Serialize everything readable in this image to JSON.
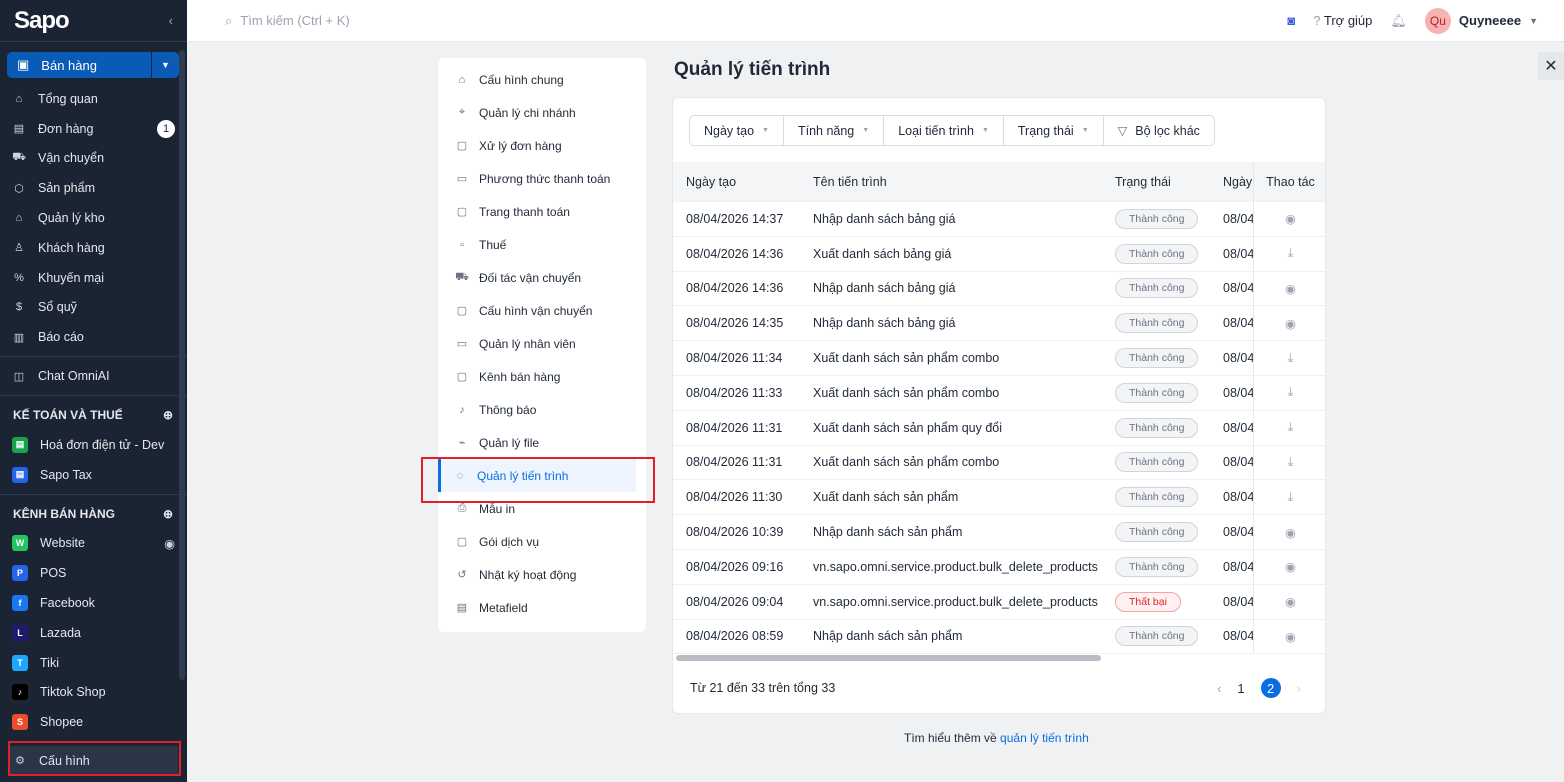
{
  "sidebar": {
    "brand": "Sapo",
    "channel_select": "Bán hàng",
    "items": [
      {
        "icon": "home-icon",
        "g": "⌂",
        "label": "Tổng quan"
      },
      {
        "icon": "order-icon",
        "g": "▤",
        "label": "Đơn hàng",
        "badge": "1"
      },
      {
        "icon": "truck-icon",
        "g": "⛟",
        "label": "Vận chuyển"
      },
      {
        "icon": "box-icon",
        "g": "⬡",
        "label": "Sản phẩm"
      },
      {
        "icon": "warehouse-icon",
        "g": "⌂",
        "label": "Quản lý kho"
      },
      {
        "icon": "user-icon",
        "g": "♙",
        "label": "Khách hàng"
      },
      {
        "icon": "discount-icon",
        "g": "%",
        "label": "Khuyến mại"
      },
      {
        "icon": "cashbook-icon",
        "g": "$",
        "label": "Sổ quỹ"
      },
      {
        "icon": "chart-icon",
        "g": "▥",
        "label": "Báo cáo"
      }
    ],
    "chat": "Chat OmniAI",
    "accounting": {
      "title": "KẾ TOÁN VÀ THUẾ",
      "items": [
        {
          "label": "Hoá đơn điện tử - Dev",
          "color": "#16a34a"
        },
        {
          "label": "Sapo Tax",
          "color": "#2563eb"
        }
      ]
    },
    "channels": {
      "title": "KÊNH BÁN HÀNG",
      "items": [
        {
          "label": "Website",
          "color": "#22c55e",
          "g": "W"
        },
        {
          "label": "POS",
          "color": "#2563eb",
          "g": "P"
        },
        {
          "label": "Facebook",
          "color": "#1877f2",
          "g": "f"
        },
        {
          "label": "Lazada",
          "color": "#1e1b6e",
          "g": "L"
        },
        {
          "label": "Tiki",
          "color": "#1ba8ff",
          "g": "T"
        },
        {
          "label": "Tiktok Shop",
          "color": "#000000",
          "g": "♪"
        },
        {
          "label": "Shopee",
          "color": "#ee4d2d",
          "g": "S"
        }
      ]
    },
    "settings": "Cấu hình"
  },
  "topbar": {
    "search_placeholder": "Tìm kiếm (Ctrl + K)",
    "help": "Trợ giúp",
    "avatar": "Qu",
    "user": "Quyneeee"
  },
  "settings_menu": [
    {
      "label": "Cấu hình chung",
      "g": "⌂"
    },
    {
      "label": "Quản lý chi nhánh",
      "g": "⌖"
    },
    {
      "label": "Xử lý đơn hàng",
      "g": "▢"
    },
    {
      "label": "Phương thức thanh toán",
      "g": "▭"
    },
    {
      "label": "Trang thanh toán",
      "g": "▢"
    },
    {
      "label": "Thuế",
      "g": "▫"
    },
    {
      "label": "Đối tác vận chuyển",
      "g": "⛟"
    },
    {
      "label": "Cấu hình vận chuyển",
      "g": "▢"
    },
    {
      "label": "Quản lý nhân viên",
      "g": "▭"
    },
    {
      "label": "Kênh bán hàng",
      "g": "▢"
    },
    {
      "label": "Thông báo",
      "g": "♪"
    },
    {
      "label": "Quản lý file",
      "g": "⌁"
    },
    {
      "label": "Quản lý tiến trình",
      "g": "◌",
      "active": true
    },
    {
      "label": "Mẫu in",
      "g": "⎙"
    },
    {
      "label": "Gói dịch vụ",
      "g": "▢"
    },
    {
      "label": "Nhật ký hoạt động",
      "g": "↺"
    },
    {
      "label": "Metafield",
      "g": "▤"
    }
  ],
  "page": {
    "title": "Quản lý tiến trình",
    "filters": [
      "Ngày tạo",
      "Tính năng",
      "Loại tiến trình",
      "Trạng thái"
    ],
    "more_filter": "Bộ lọc khác",
    "columns": [
      "Ngày tạo",
      "Tên tiến trình",
      "Trạng thái",
      "Ngày",
      "Thao tác"
    ],
    "rows": [
      [
        "08/04/2026 14:37",
        "Nhập danh sách bảng giá",
        "Thành công",
        "08/04",
        "view"
      ],
      [
        "08/04/2026 14:36",
        "Xuất danh sách bảng giá",
        "Thành công",
        "08/04",
        "download"
      ],
      [
        "08/04/2026 14:36",
        "Nhập danh sách bảng giá",
        "Thành công",
        "08/04",
        "view"
      ],
      [
        "08/04/2026 14:35",
        "Nhập danh sách bảng giá",
        "Thành công",
        "08/04",
        "view"
      ],
      [
        "08/04/2026 11:34",
        "Xuất danh sách sản phẩm combo",
        "Thành công",
        "08/04",
        "download"
      ],
      [
        "08/04/2026 11:33",
        "Xuất danh sách sản phẩm combo",
        "Thành công",
        "08/04",
        "download"
      ],
      [
        "08/04/2026 11:31",
        "Xuất danh sách sản phẩm quy đổi",
        "Thành công",
        "08/04",
        "download"
      ],
      [
        "08/04/2026 11:31",
        "Xuất danh sách sản phẩm combo",
        "Thành công",
        "08/04",
        "download"
      ],
      [
        "08/04/2026 11:30",
        "Xuất danh sách sản phẩm",
        "Thành công",
        "08/04",
        "download"
      ],
      [
        "08/04/2026 10:39",
        "Nhập danh sách sản phẩm",
        "Thành công",
        "08/04",
        "view"
      ],
      [
        "08/04/2026 09:16",
        "vn.sapo.omni.service.product.bulk_delete_products",
        "Thành công",
        "08/04",
        "view"
      ],
      [
        "08/04/2026 09:04",
        "vn.sapo.omni.service.product.bulk_delete_products",
        "Thất bại",
        "08/04",
        "view"
      ],
      [
        "08/04/2026 08:59",
        "Nhập danh sách sản phẩm",
        "Thành công",
        "08/04",
        "view"
      ]
    ],
    "summary": "Từ 21 đến 33 trên tổng 33",
    "pages": [
      "1",
      "2"
    ],
    "current_page": "2",
    "learn_prefix": "Tìm hiểu thêm về",
    "learn_link": "quản lý tiến trình"
  }
}
